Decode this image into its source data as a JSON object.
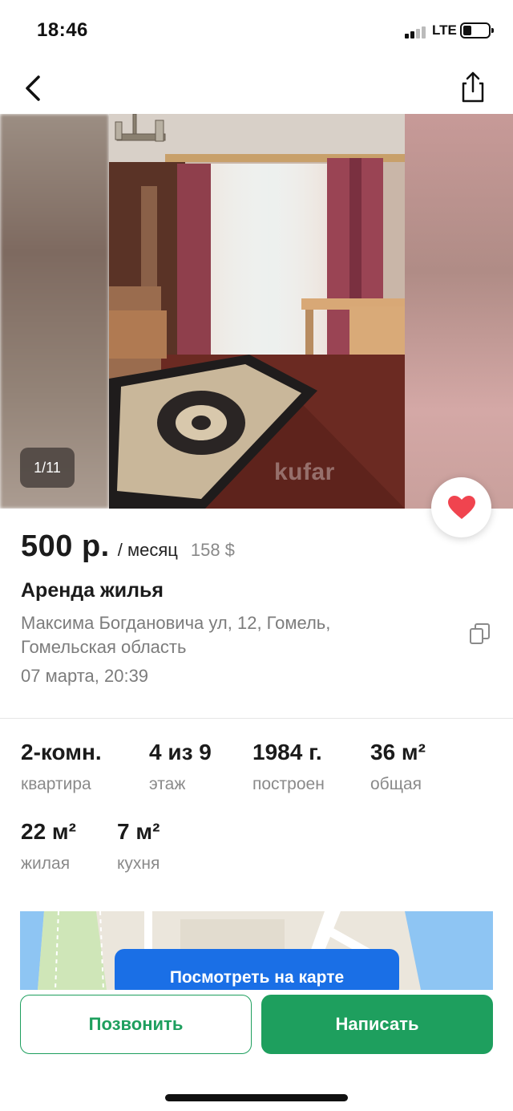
{
  "status_bar": {
    "time": "18:46",
    "network": "LTE",
    "battery_level": 0.3
  },
  "nav": {
    "back_icon": "chevron-left-icon",
    "share_icon": "share-icon"
  },
  "gallery": {
    "counter": "1/11",
    "watermark": "kufar"
  },
  "favorite": {
    "icon": "heart-icon",
    "color": "#f0444f",
    "active": true
  },
  "listing": {
    "price": "500 р.",
    "period": "/ месяц",
    "price_usd": "158 $",
    "title": "Аренда жилья",
    "address": "Максима Богдановича ул, 12, Гомель, Гомельская область",
    "date": "07 марта, 20:39"
  },
  "params": [
    {
      "value": "2-комн.",
      "label": "квартира"
    },
    {
      "value": "4 из 9",
      "label": "этаж"
    },
    {
      "value": "1984 г.",
      "label": "построен"
    },
    {
      "value": "36 м²",
      "label": "общая"
    },
    {
      "value": "22 м²",
      "label": "жилая"
    },
    {
      "value": "7 м²",
      "label": "кухня"
    }
  ],
  "map": {
    "button_label": "Посмотреть на карте"
  },
  "actions": {
    "call_label": "Позвонить",
    "write_label": "Написать",
    "accent_color": "#1e9f5e"
  }
}
